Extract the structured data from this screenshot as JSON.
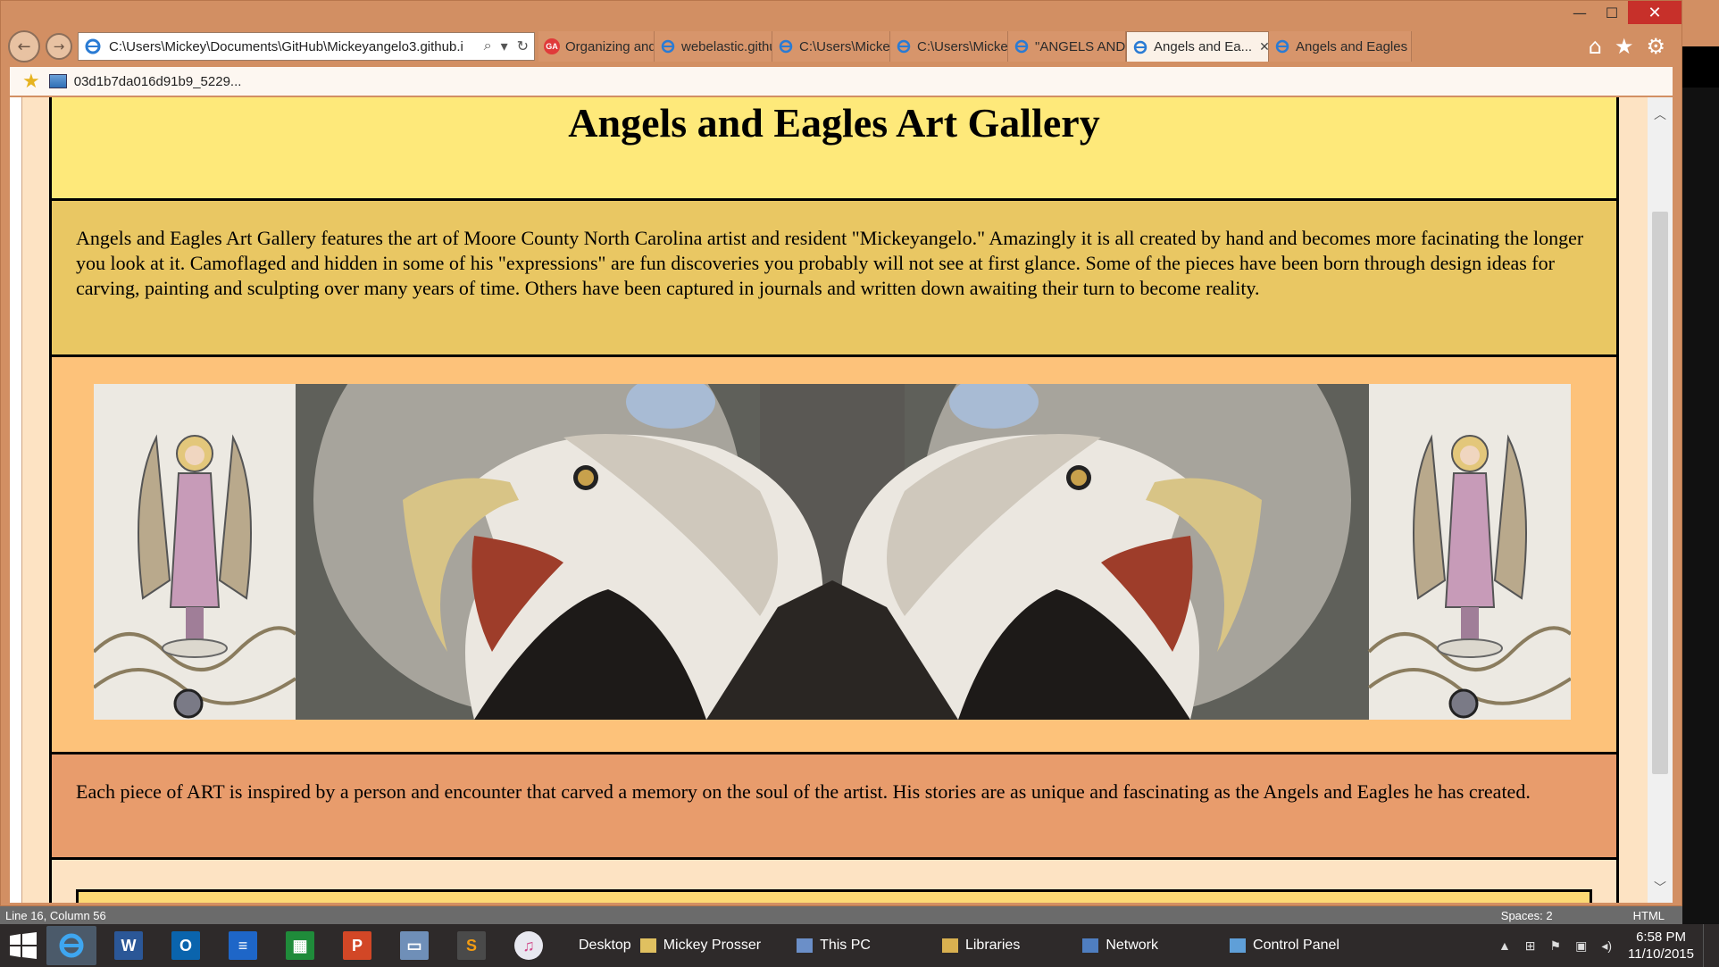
{
  "browser": {
    "address": "C:\\Users\\Mickey\\Documents\\GitHub\\Mickeyangelo3.github.i",
    "tabs": [
      {
        "label": "Organizing and V...",
        "icon": "ga"
      },
      {
        "label": "webelastic.github...",
        "icon": "ie"
      },
      {
        "label": "C:\\Users\\Mickey\\...",
        "icon": "ie"
      },
      {
        "label": "C:\\Users\\Mickey\\...",
        "icon": "ie"
      },
      {
        "label": "\"ANGELS AND E...",
        "icon": "ie"
      },
      {
        "label": "Angels and Ea...",
        "icon": "ie",
        "active": true
      },
      {
        "label": "Angels and Eagles",
        "icon": "ie"
      }
    ],
    "ga_text": "GA",
    "favorite": "03d1b7da016d91b9_5229...",
    "window_buttons": {
      "minimize": "—",
      "maximize": "☐",
      "close": "✕"
    }
  },
  "page": {
    "title": "Angels and Eagles Art Gallery",
    "intro": "Angels and Eagles Art Gallery features the art of Moore County North Carolina artist and resident \"Mickeyangelo.\" Amazingly it is all created by hand and becomes more facinating the longer you look at it. Camoflaged and hidden in some of his \"expressions\" are fun discoveries you probably will not see at first glance. Some of the pieces have been born through design ideas for carving, painting and sculpting over many years of time. Others have been captured in journals and written down awaiting their turn to become reality.",
    "story": "Each piece of ART is inspired by a person and encounter that carved a memory on the soul of the artist. His stories are as unique and fascinating as the Angels and Eagles he has created.",
    "colors": {
      "header_bg": "#fee97a",
      "intro_bg": "#e9c763",
      "banner_bg": "#fdc27a",
      "story_bg": "#e89c6c"
    }
  },
  "status": {
    "position": "Line 16, Column 56",
    "spaces": "Spaces: 2",
    "syntax": "HTML"
  },
  "taskbar": {
    "links": [
      "Desktop",
      "Mickey Prosser",
      "This PC",
      "Libraries",
      "Network",
      "Control Panel"
    ],
    "time": "6:58 PM",
    "date": "11/10/2015",
    "apps": [
      "internet-explorer",
      "word",
      "outlook",
      "sublime-like-editor",
      "calculator",
      "powerpoint",
      "remote-desktop",
      "sublime-text",
      "itunes"
    ]
  }
}
